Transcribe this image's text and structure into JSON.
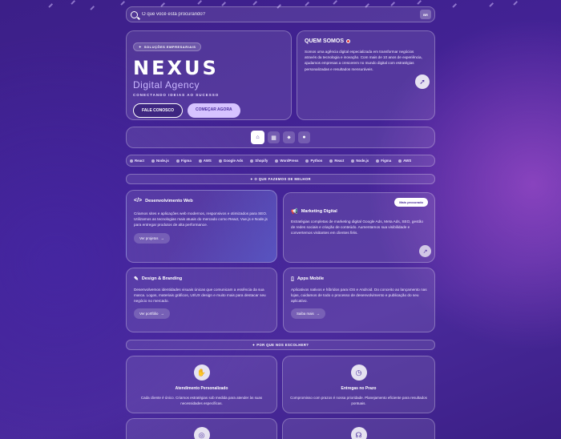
{
  "search": {
    "placeholder": "O que você está procurando?",
    "mini_label": "BR"
  },
  "hero": {
    "badge": "SOLUÇÕES EMPRESARIAIS",
    "brand": "NEXUS",
    "subtitle": "Digital Agency",
    "tagline": "CONECTANDO IDEIAS AO SUCESSO",
    "primary_button": "FALE CONOSCO",
    "secondary_button": "COMEÇAR AGORA"
  },
  "about": {
    "title": "QUEM SOMOS",
    "text": "Somos uma agência digital especializada em transformar negócios através da tecnologia e inovação. Com mais de 10 anos de experiência, ajudamos empresas a crescerem no mundo digital com estratégias personalizadas e resultados mensuráveis."
  },
  "nav": {
    "items": [
      "home-icon",
      "grid-icon",
      "gear-icon",
      "user-icon"
    ]
  },
  "ticker": [
    "React",
    "Node.js",
    "Figma",
    "AWS",
    "Google Ads",
    "Shopify",
    "WordPress",
    "Python",
    "React",
    "Node.js",
    "Figma",
    "AWS"
  ],
  "services": {
    "heading": "O QUE FAZEMOS DE MELHOR",
    "cards": [
      {
        "title": "Desenvolvimento Web",
        "icon": "code-icon",
        "text": "Criamos sites e aplicações web modernos, responsivos e otimizados para SEO. Utilizamos as tecnologias mais atuais do mercado como React, Vue.js e Node.js para entregar produtos de alta performance.",
        "link": "Ver projetos"
      },
      {
        "title": "Marketing Digital",
        "icon": "megaphone-icon",
        "badge": "Mais procurado",
        "text": "Estratégias completas de marketing digital Google Ads, Meta Ads, SEO, gestão de redes sociais e criação de conteúdo. Aumentamos sua visibilidade e convertemos visitantes em clientes fiéis."
      },
      {
        "title": "Design & Branding",
        "icon": "brush-icon",
        "text": "Desenvolvemos identidades visuais únicas que comunicam a essência da sua marca. Logos, materiais gráficos, UI/UX design e muito mais para destacar seu negócio no mercado.",
        "link": "Ver portfólio"
      },
      {
        "title": "Apps Mobile",
        "icon": "mobile-icon",
        "text": "Aplicativos nativos e híbridos para iOS e Android. Do conceito ao lançamento nas lojas, cuidamos de todo o processo de desenvolvimento e publicação do seu aplicativo.",
        "link": "Saiba mais"
      }
    ]
  },
  "why": {
    "heading": "POR QUE NOS ESCOLHER?",
    "items": [
      {
        "title": "Atendimento Personalizado",
        "icon": "handshake-icon",
        "text": "Cada cliente é único. Criamos estratégias sob medida para atender às suas necessidades específicas."
      },
      {
        "title": "Entregas no Prazo",
        "icon": "clock-icon",
        "text": "Compromisso com prazos é nossa prioridade. Planejamento eficiente para resultados pontuais."
      }
    ]
  },
  "colors": {
    "accent": "#d6c3ff",
    "brand_purple": "#4a2c9e"
  }
}
